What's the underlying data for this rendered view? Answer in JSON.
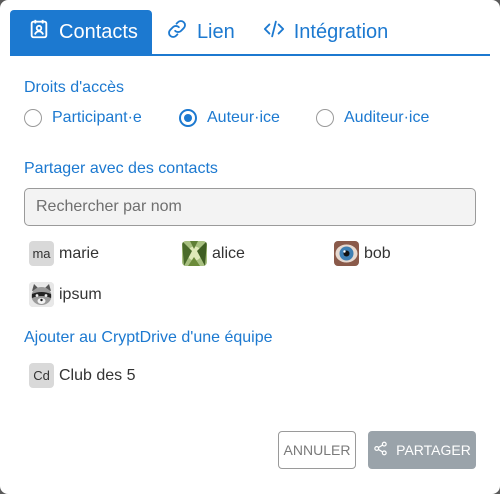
{
  "tabs": [
    {
      "label": "Contacts",
      "icon": "contacts-icon",
      "active": true
    },
    {
      "label": "Lien",
      "icon": "link-icon",
      "active": false
    },
    {
      "label": "Intégration",
      "icon": "code-icon",
      "active": false
    }
  ],
  "access": {
    "title": "Droits d'accès",
    "options": [
      {
        "label": "Participant·e",
        "checked": false
      },
      {
        "label": "Auteur·ice",
        "checked": true
      },
      {
        "label": "Auditeur·ice",
        "checked": false
      }
    ]
  },
  "share": {
    "title": "Partager avec des contacts",
    "search_placeholder": "Rechercher par nom",
    "search_value": ""
  },
  "contacts": [
    {
      "name": "marie",
      "avatar_text": "ma",
      "avatar_type": "initials"
    },
    {
      "name": "alice",
      "avatar_type": "image-forest"
    },
    {
      "name": "bob",
      "avatar_type": "image-eye"
    },
    {
      "name": "ipsum",
      "avatar_type": "image-raccoon"
    }
  ],
  "teams": {
    "title": "Ajouter au CryptDrive d'une équipe",
    "items": [
      {
        "name": "Club des 5",
        "avatar_text": "Cd"
      }
    ]
  },
  "buttons": {
    "cancel": "ANNULER",
    "share": "PARTAGER"
  },
  "colors": {
    "accent": "#1c79d0",
    "share_button": "#9aa3aa",
    "background": "#ffffff"
  }
}
